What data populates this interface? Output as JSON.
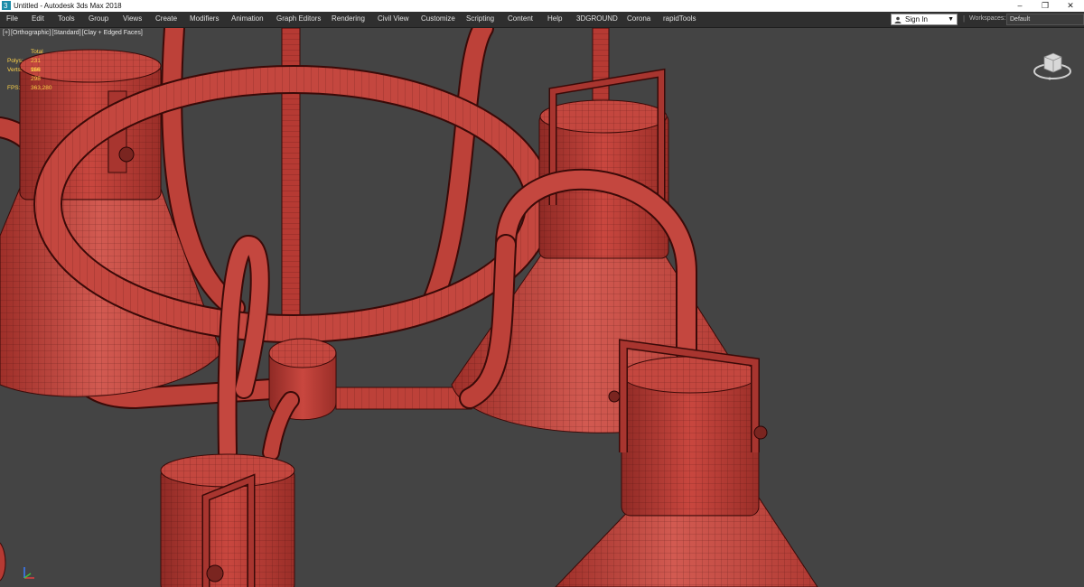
{
  "window": {
    "title": "Untitled - Autodesk 3ds Max 2018",
    "controls": {
      "minimize": "–",
      "restore": "❐",
      "close": "✕"
    }
  },
  "menu": [
    "File",
    "Edit",
    "Tools",
    "Group",
    "Views",
    "Create",
    "Modifiers",
    "Animation",
    "Graph Editors",
    "Rendering",
    "Civil View",
    "Customize",
    "Scripting",
    "Content",
    "Help",
    "3DGROUND",
    "Corona",
    "rapidTools"
  ],
  "signin": {
    "label": "Sign In",
    "caret": "▼"
  },
  "workspaces": {
    "label": "Workspaces:",
    "value": "Default"
  },
  "viewport": {
    "labels": [
      "[+]",
      "[Orthographic]",
      "[Standard]",
      "[Clay + Edged Faces]"
    ],
    "stats": {
      "header": "Total",
      "rows": [
        {
          "key": "Polys:",
          "value": "231 968"
        },
        {
          "key": "Verts:",
          "value": "116 298"
        },
        {
          "key": "FPS:",
          "value": "363,280"
        }
      ]
    }
  },
  "colors": {
    "viewport_bg": "#444444",
    "clay": "#c2473f",
    "wire": "#3a0a08",
    "stats": "#ffd34a",
    "menubar": "#2f2f2f"
  },
  "icons": [
    "max-app-icon",
    "user-icon",
    "viewcube-icon",
    "axis-tripod-icon"
  ]
}
